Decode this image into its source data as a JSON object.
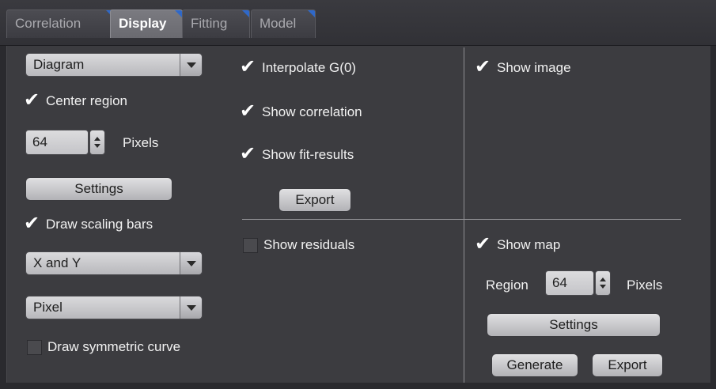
{
  "tabs": [
    {
      "label": "Correlation",
      "active": false
    },
    {
      "label": "Display",
      "active": true
    },
    {
      "label": "Fitting",
      "active": false
    },
    {
      "label": "Model",
      "active": false
    }
  ],
  "left": {
    "diagram_dropdown": "Diagram",
    "center_region": {
      "label": "Center region",
      "checked": true
    },
    "pixels_value": "64",
    "pixels_label": "Pixels",
    "settings_label": "Settings",
    "draw_scaling_bars": {
      "label": "Draw scaling bars",
      "checked": true
    },
    "axes_dropdown": "X and Y",
    "units_dropdown": "Pixel",
    "draw_symmetric_curve": {
      "label": "Draw symmetric curve",
      "checked": false
    }
  },
  "middle": {
    "interpolate": {
      "label": "Interpolate G(0)",
      "checked": true
    },
    "show_correlation": {
      "label": "Show correlation",
      "checked": true
    },
    "show_fit_results": {
      "label": "Show fit-results",
      "checked": true
    },
    "export_label": "Export",
    "show_residuals": {
      "label": "Show residuals",
      "checked": false
    }
  },
  "right": {
    "show_image": {
      "label": "Show image",
      "checked": true
    },
    "show_map": {
      "label": "Show map",
      "checked": true
    },
    "region_label": "Region",
    "region_value": "64",
    "pixels_label": "Pixels",
    "settings_label": "Settings",
    "generate_label": "Generate",
    "export_label": "Export"
  },
  "colors": {
    "tab_corner": "#2f68c8",
    "background": "#3c3c40"
  }
}
